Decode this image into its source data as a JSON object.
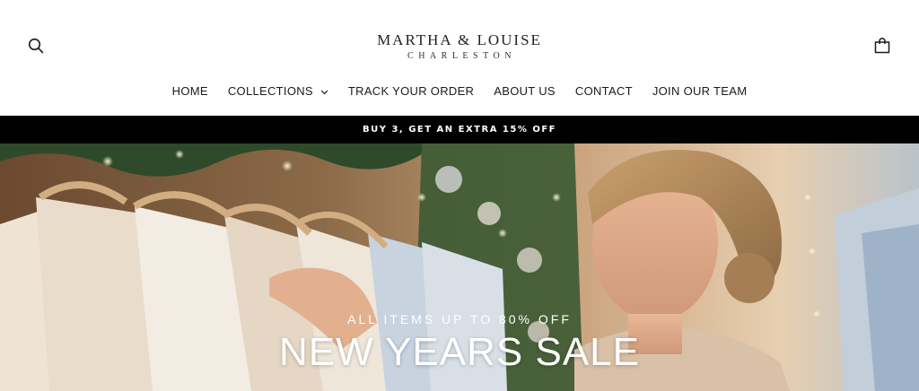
{
  "header": {
    "logo": {
      "name": "MARTHA & LOUISE",
      "location": "CHARLESTON"
    },
    "icons": {
      "search": "search-icon",
      "cart": "shopping-bag-icon"
    }
  },
  "nav": {
    "items": [
      {
        "label": "HOME"
      },
      {
        "label": "COLLECTIONS",
        "has_dropdown": true
      },
      {
        "label": "TRACK YOUR ORDER"
      },
      {
        "label": "ABOUT US"
      },
      {
        "label": "CONTACT"
      },
      {
        "label": "JOIN OUR TEAM"
      }
    ]
  },
  "announcement": {
    "text": "BUY 3, GET AN EXTRA 15% OFF"
  },
  "hero": {
    "subtitle": "ALL ITEMS UP TO 80% OFF",
    "title": "NEW YEARS SALE"
  },
  "colors": {
    "announcement_bg": "#000000",
    "header_bg": "#ffffff",
    "text": "#1a1a1a"
  }
}
